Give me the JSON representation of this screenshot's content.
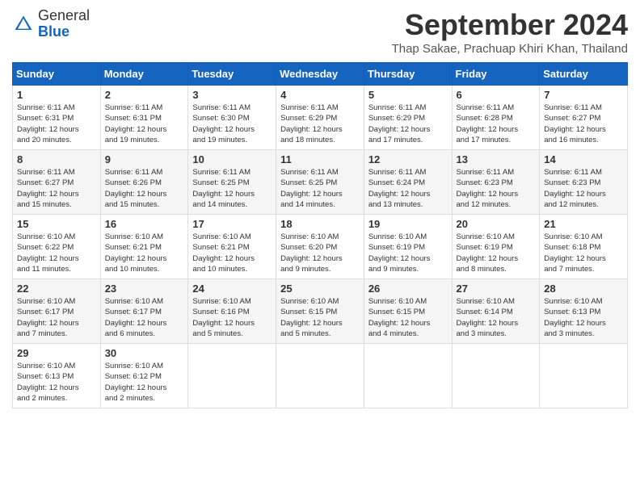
{
  "logo": {
    "general": "General",
    "blue": "Blue"
  },
  "title": "September 2024",
  "location": "Thap Sakae, Prachuap Khiri Khan, Thailand",
  "days_header": [
    "Sunday",
    "Monday",
    "Tuesday",
    "Wednesday",
    "Thursday",
    "Friday",
    "Saturday"
  ],
  "weeks": [
    [
      {
        "day": "1",
        "sunrise": "6:11 AM",
        "sunset": "6:31 PM",
        "daylight": "12 hours and 20 minutes."
      },
      {
        "day": "2",
        "sunrise": "6:11 AM",
        "sunset": "6:31 PM",
        "daylight": "12 hours and 19 minutes."
      },
      {
        "day": "3",
        "sunrise": "6:11 AM",
        "sunset": "6:30 PM",
        "daylight": "12 hours and 19 minutes."
      },
      {
        "day": "4",
        "sunrise": "6:11 AM",
        "sunset": "6:29 PM",
        "daylight": "12 hours and 18 minutes."
      },
      {
        "day": "5",
        "sunrise": "6:11 AM",
        "sunset": "6:29 PM",
        "daylight": "12 hours and 17 minutes."
      },
      {
        "day": "6",
        "sunrise": "6:11 AM",
        "sunset": "6:28 PM",
        "daylight": "12 hours and 17 minutes."
      },
      {
        "day": "7",
        "sunrise": "6:11 AM",
        "sunset": "6:27 PM",
        "daylight": "12 hours and 16 minutes."
      }
    ],
    [
      {
        "day": "8",
        "sunrise": "6:11 AM",
        "sunset": "6:27 PM",
        "daylight": "12 hours and 15 minutes."
      },
      {
        "day": "9",
        "sunrise": "6:11 AM",
        "sunset": "6:26 PM",
        "daylight": "12 hours and 15 minutes."
      },
      {
        "day": "10",
        "sunrise": "6:11 AM",
        "sunset": "6:25 PM",
        "daylight": "12 hours and 14 minutes."
      },
      {
        "day": "11",
        "sunrise": "6:11 AM",
        "sunset": "6:25 PM",
        "daylight": "12 hours and 14 minutes."
      },
      {
        "day": "12",
        "sunrise": "6:11 AM",
        "sunset": "6:24 PM",
        "daylight": "12 hours and 13 minutes."
      },
      {
        "day": "13",
        "sunrise": "6:11 AM",
        "sunset": "6:23 PM",
        "daylight": "12 hours and 12 minutes."
      },
      {
        "day": "14",
        "sunrise": "6:11 AM",
        "sunset": "6:23 PM",
        "daylight": "12 hours and 12 minutes."
      }
    ],
    [
      {
        "day": "15",
        "sunrise": "6:10 AM",
        "sunset": "6:22 PM",
        "daylight": "12 hours and 11 minutes."
      },
      {
        "day": "16",
        "sunrise": "6:10 AM",
        "sunset": "6:21 PM",
        "daylight": "12 hours and 10 minutes."
      },
      {
        "day": "17",
        "sunrise": "6:10 AM",
        "sunset": "6:21 PM",
        "daylight": "12 hours and 10 minutes."
      },
      {
        "day": "18",
        "sunrise": "6:10 AM",
        "sunset": "6:20 PM",
        "daylight": "12 hours and 9 minutes."
      },
      {
        "day": "19",
        "sunrise": "6:10 AM",
        "sunset": "6:19 PM",
        "daylight": "12 hours and 9 minutes."
      },
      {
        "day": "20",
        "sunrise": "6:10 AM",
        "sunset": "6:19 PM",
        "daylight": "12 hours and 8 minutes."
      },
      {
        "day": "21",
        "sunrise": "6:10 AM",
        "sunset": "6:18 PM",
        "daylight": "12 hours and 7 minutes."
      }
    ],
    [
      {
        "day": "22",
        "sunrise": "6:10 AM",
        "sunset": "6:17 PM",
        "daylight": "12 hours and 7 minutes."
      },
      {
        "day": "23",
        "sunrise": "6:10 AM",
        "sunset": "6:17 PM",
        "daylight": "12 hours and 6 minutes."
      },
      {
        "day": "24",
        "sunrise": "6:10 AM",
        "sunset": "6:16 PM",
        "daylight": "12 hours and 5 minutes."
      },
      {
        "day": "25",
        "sunrise": "6:10 AM",
        "sunset": "6:15 PM",
        "daylight": "12 hours and 5 minutes."
      },
      {
        "day": "26",
        "sunrise": "6:10 AM",
        "sunset": "6:15 PM",
        "daylight": "12 hours and 4 minutes."
      },
      {
        "day": "27",
        "sunrise": "6:10 AM",
        "sunset": "6:14 PM",
        "daylight": "12 hours and 3 minutes."
      },
      {
        "day": "28",
        "sunrise": "6:10 AM",
        "sunset": "6:13 PM",
        "daylight": "12 hours and 3 minutes."
      }
    ],
    [
      {
        "day": "29",
        "sunrise": "6:10 AM",
        "sunset": "6:13 PM",
        "daylight": "12 hours and 2 minutes."
      },
      {
        "day": "30",
        "sunrise": "6:10 AM",
        "sunset": "6:12 PM",
        "daylight": "12 hours and 2 minutes."
      },
      null,
      null,
      null,
      null,
      null
    ]
  ]
}
